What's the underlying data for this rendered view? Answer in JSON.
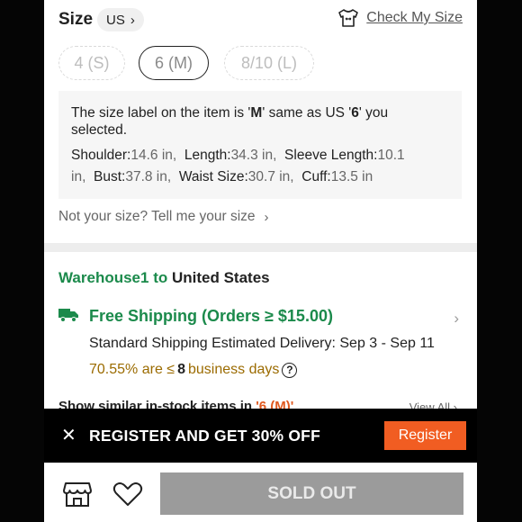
{
  "size_section": {
    "title": "Size",
    "region": "US",
    "check_size_label": "Check My Size",
    "options": [
      {
        "label": "4 (S)",
        "state": "disabled"
      },
      {
        "label": "6 (M)",
        "state": "selected"
      },
      {
        "label": "8/10 (L)",
        "state": "disabled"
      }
    ],
    "info": {
      "part1": "The size label on the item is '",
      "label": "M",
      "part2": "' same as US '",
      "us": "6",
      "part3": "' you selected."
    },
    "measurements": [
      {
        "name": "Shoulder:",
        "value": "14.6 in,"
      },
      {
        "name": "Length:",
        "value": "34.3 in,"
      },
      {
        "name": "Sleeve Length:",
        "value": "10.1 in,"
      },
      {
        "name": "Bust:",
        "value": "37.8 in,"
      },
      {
        "name": "Waist Size:",
        "value": "30.7 in,"
      },
      {
        "name": "Cuff:",
        "value": "13.5 in"
      }
    ],
    "not_your_size": "Not your size? Tell me your size"
  },
  "shipping": {
    "warehouse": "Warehouse1",
    "to_word": "to",
    "destination": "United States",
    "free_shipping": "Free Shipping (Orders ≥ $15.00)",
    "standard": "Standard Shipping Estimated Delivery: Sep 3 - Sep 11",
    "pct": "70.55% are ≤",
    "days_num": "8",
    "days_word": "business days"
  },
  "similar": {
    "text": "Show similar in-stock items in",
    "size": "'6 (M)'",
    "view_all": "View All"
  },
  "banner": {
    "text": "REGISTER AND GET 30% OFF",
    "register_label": "Register"
  },
  "bottom": {
    "sold_out_label": "SOLD OUT"
  },
  "colors": {
    "green": "#1b8a4b",
    "orange": "#f15d22",
    "sold_out_bg": "#9b9b9b"
  },
  "icons": [
    "chevron-right-icon",
    "shirt-icon",
    "truck-icon",
    "question-icon",
    "close-icon",
    "store-icon",
    "heart-icon"
  ]
}
